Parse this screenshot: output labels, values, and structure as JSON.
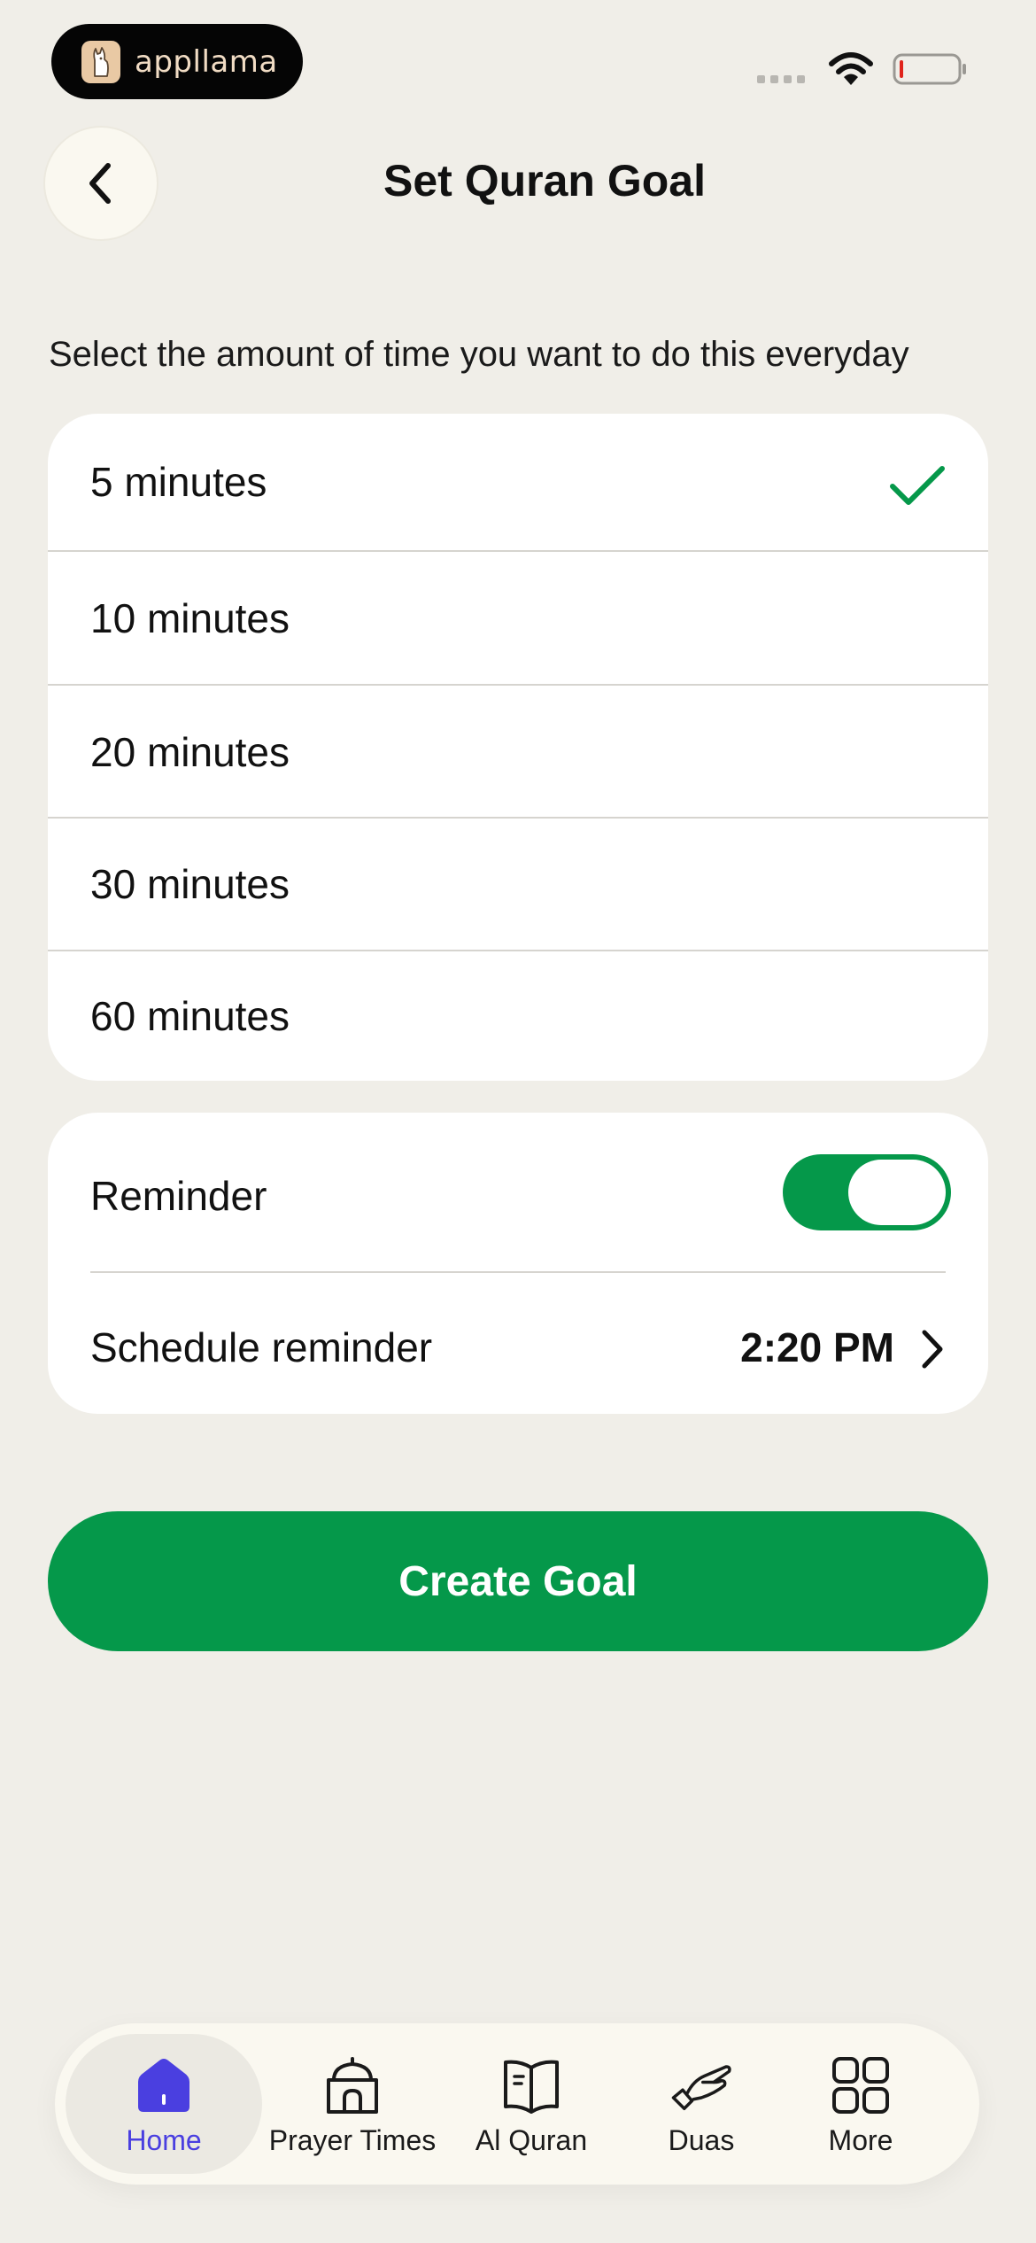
{
  "status_bar": {
    "brand": "appllama"
  },
  "header": {
    "title": "Set Quran Goal",
    "back_icon": "chevron-left-icon"
  },
  "instruction": "Select the amount of time you want to do this everyday",
  "duration_options": [
    {
      "label": "5 minutes",
      "selected": true
    },
    {
      "label": "10 minutes",
      "selected": false
    },
    {
      "label": "20 minutes",
      "selected": false
    },
    {
      "label": "30 minutes",
      "selected": false
    },
    {
      "label": "60 minutes",
      "selected": false
    }
  ],
  "reminder": {
    "label": "Reminder",
    "enabled": true,
    "schedule_label": "Schedule reminder",
    "schedule_time": "2:20 PM"
  },
  "create_button": "Create Goal",
  "bottom_nav": [
    {
      "label": "Home",
      "icon": "home-icon",
      "active": true
    },
    {
      "label": "Prayer Times",
      "icon": "mosque-icon",
      "active": false
    },
    {
      "label": "Al Quran",
      "icon": "book-icon",
      "active": false
    },
    {
      "label": "Duas",
      "icon": "praying-hands-icon",
      "active": false
    },
    {
      "label": "More",
      "icon": "grid-icon",
      "active": false
    }
  ],
  "colors": {
    "background": "#F0EEE8",
    "accent_green": "#05984A",
    "active_nav": "#4A3FE0"
  }
}
